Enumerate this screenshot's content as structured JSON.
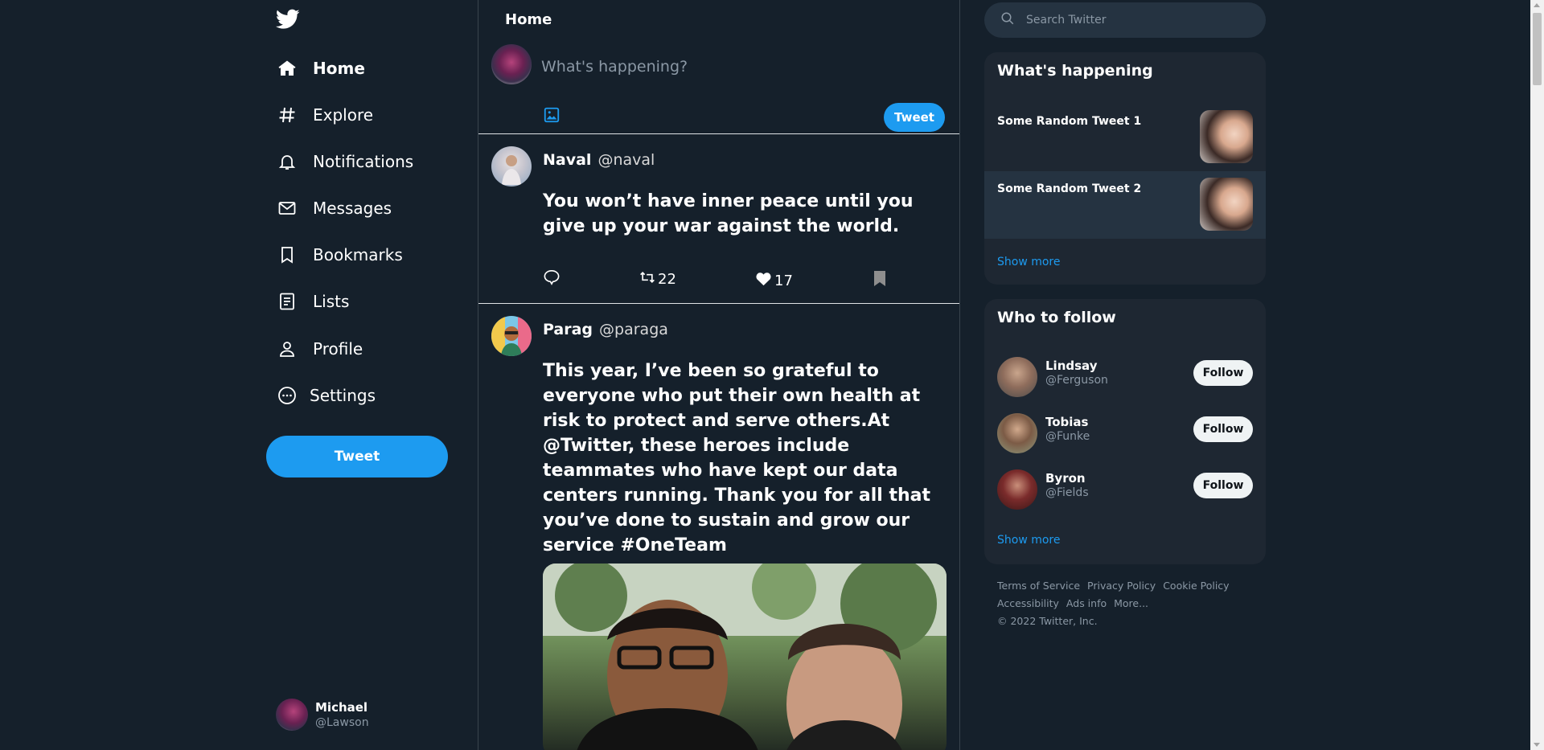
{
  "nav": {
    "items": [
      {
        "label": "Home",
        "icon": "home-icon"
      },
      {
        "label": "Explore",
        "icon": "hashtag-icon"
      },
      {
        "label": "Notifications",
        "icon": "bell-icon"
      },
      {
        "label": "Messages",
        "icon": "envelope-icon"
      },
      {
        "label": "Bookmarks",
        "icon": "bookmark-icon"
      },
      {
        "label": "Lists",
        "icon": "list-icon"
      },
      {
        "label": "Profile",
        "icon": "person-icon"
      },
      {
        "label": "Settings",
        "icon": "more-circle-icon"
      }
    ],
    "tweet_button": "Tweet"
  },
  "account": {
    "name": "Michael",
    "handle": "@Lawson"
  },
  "main": {
    "title": "Home",
    "composer": {
      "placeholder": "What's happening?",
      "tweet_button": "Tweet"
    },
    "posts": [
      {
        "name": "Naval",
        "handle": "@naval",
        "text": "You won’t have inner peace until you give up your war against the world.",
        "retweets": "22",
        "likes": "17"
      },
      {
        "name": "Parag",
        "handle": "@paraga",
        "text": "This year, I’ve been so grateful to everyone who put their own health at risk to protect and serve others.At @Twitter, these heroes include teammates who have kept our data centers running. Thank you for all that you’ve done to sustain and grow our service #OneTeam"
      }
    ]
  },
  "right": {
    "search_placeholder": "Search Twitter",
    "happening": {
      "title": "What's happening",
      "items": [
        {
          "title": "Some Random Tweet 1"
        },
        {
          "title": "Some Random Tweet 2"
        }
      ],
      "show_more": "Show more"
    },
    "who_to_follow": {
      "title": "Who to follow",
      "users": [
        {
          "name": "Lindsay",
          "handle": "@Ferguson",
          "button": "Follow"
        },
        {
          "name": "Tobias",
          "handle": "@Funke",
          "button": "Follow"
        },
        {
          "name": "Byron",
          "handle": "@Fields",
          "button": "Follow"
        }
      ],
      "show_more": "Show more"
    },
    "footer": {
      "links": [
        "Terms of Service",
        "Privacy Policy",
        "Cookie Policy",
        "Accessibility",
        "Ads info",
        "More..."
      ],
      "copyright": "© 2022 Twitter, Inc."
    }
  },
  "colors": {
    "background": "#15202b",
    "accent": "#1d9bf0",
    "panel": "#1e2732",
    "muted": "#8b98a5"
  }
}
